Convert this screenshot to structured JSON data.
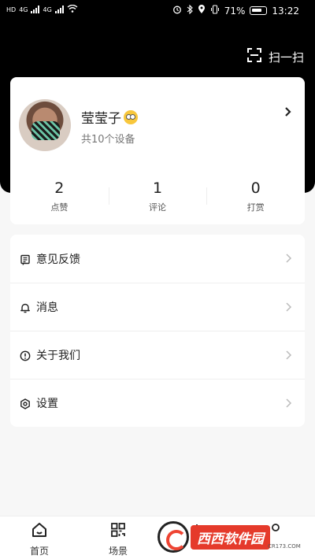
{
  "status_bar": {
    "left_1": "HD",
    "left_2": "HD",
    "net_1": "4G",
    "net_2": "4G",
    "battery_pct": "71%",
    "time": "13:22"
  },
  "header": {
    "scan_label": "扫一扫"
  },
  "profile": {
    "name": "莹莹子",
    "device_count": "共10个设备"
  },
  "stats": [
    {
      "value": "2",
      "label": "点赞"
    },
    {
      "value": "1",
      "label": "评论"
    },
    {
      "value": "0",
      "label": "打赏"
    }
  ],
  "menu": [
    {
      "label": "意见反馈",
      "icon": "feedback-icon"
    },
    {
      "label": "消息",
      "icon": "bell-icon"
    },
    {
      "label": "关于我们",
      "icon": "info-icon"
    },
    {
      "label": "设置",
      "icon": "settings-icon"
    }
  ],
  "tabbar": [
    {
      "label": "首页",
      "icon": "home-icon"
    },
    {
      "label": "场景",
      "icon": "grid-icon"
    },
    {
      "label": "",
      "icon": "sense-icon"
    },
    {
      "label": "",
      "icon": "profile-icon"
    }
  ],
  "watermark": {
    "text": "西西软件园",
    "sub": "CR173.COM"
  }
}
